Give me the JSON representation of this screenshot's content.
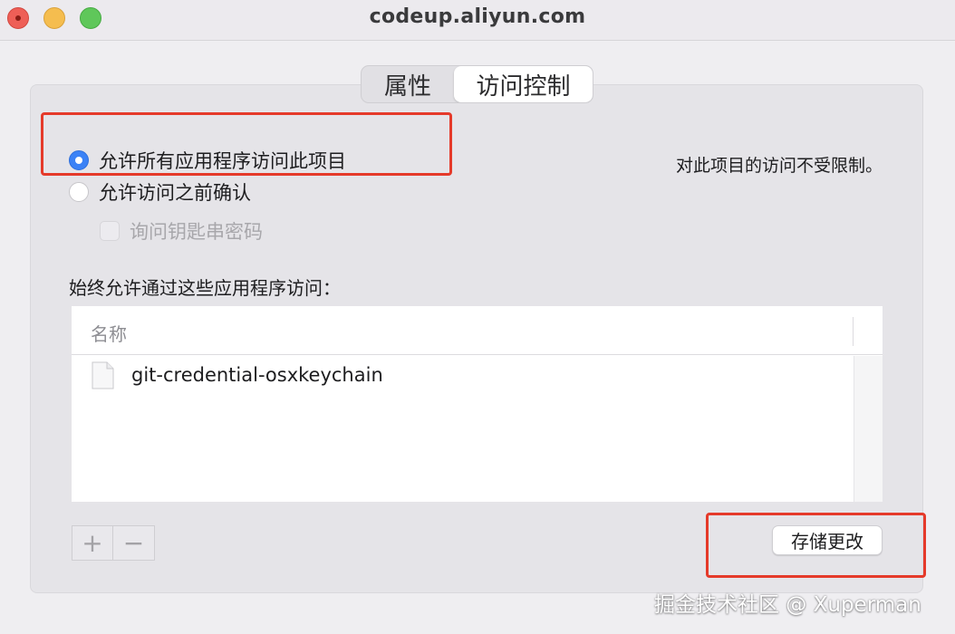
{
  "window": {
    "title": "codeup.aliyun.com"
  },
  "tabs": [
    {
      "label": "属性",
      "selected": false
    },
    {
      "label": "访问控制",
      "selected": true
    }
  ],
  "access": {
    "option_allow_all": "允许所有应用程序访问此项目",
    "option_confirm": "允许访问之前确认",
    "checkbox_ask_password": "询问钥匙串密码",
    "note": "对此项目的访问不受限制。",
    "selected_option": "option_allow_all"
  },
  "apps": {
    "section_label": "始终允许通过这些应用程序访问：",
    "column_header": "名称",
    "rows": [
      {
        "name": "git-credential-osxkeychain",
        "icon": "document-icon"
      }
    ]
  },
  "buttons": {
    "add": "+",
    "remove": "−",
    "save": "存储更改"
  },
  "watermark": "掘金技术社区 @ Xuperman",
  "colors": {
    "accent": "#3b82f6",
    "annotation": "#e53a2a",
    "close": "#ee5f57",
    "minimize": "#f5bd4f",
    "maximize": "#5fc75a"
  }
}
